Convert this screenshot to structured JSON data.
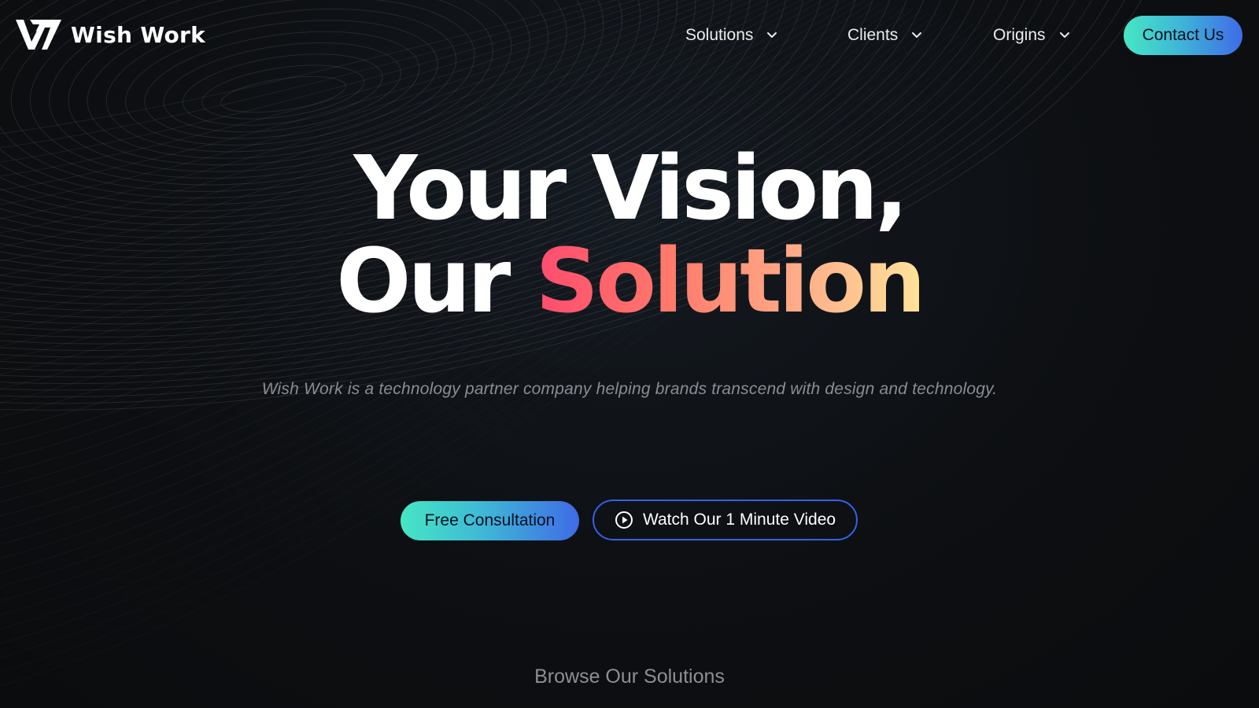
{
  "brand": {
    "name": "Wish Work",
    "logo_icon": "w-monogram-icon"
  },
  "nav": {
    "items": [
      {
        "label": "Solutions",
        "icon": "chevron-down-icon"
      },
      {
        "label": "Clients",
        "icon": "chevron-down-icon"
      },
      {
        "label": "Origins",
        "icon": "chevron-down-icon"
      }
    ],
    "contact_label": "Contact Us"
  },
  "hero": {
    "line1": "Your Vision,",
    "line2_plain": "Our ",
    "line2_highlight": "Solution",
    "subtitle": "Wish Work is a technology partner company helping brands transcend with design and technology.",
    "primary_cta": "Free Consultation",
    "secondary_cta": "Watch Our 1 Minute Video",
    "secondary_icon": "play-circle-icon"
  },
  "browse": {
    "label": "Browse Our Solutions"
  },
  "colors": {
    "background": "#0d0f12",
    "accent_gradient_start": "#46e6c4",
    "accent_gradient_end": "#3f6be6",
    "highlight_gradient_start": "#ff4b6e",
    "highlight_gradient_end": "#ffe49a",
    "outline_button": "#3561e8"
  }
}
